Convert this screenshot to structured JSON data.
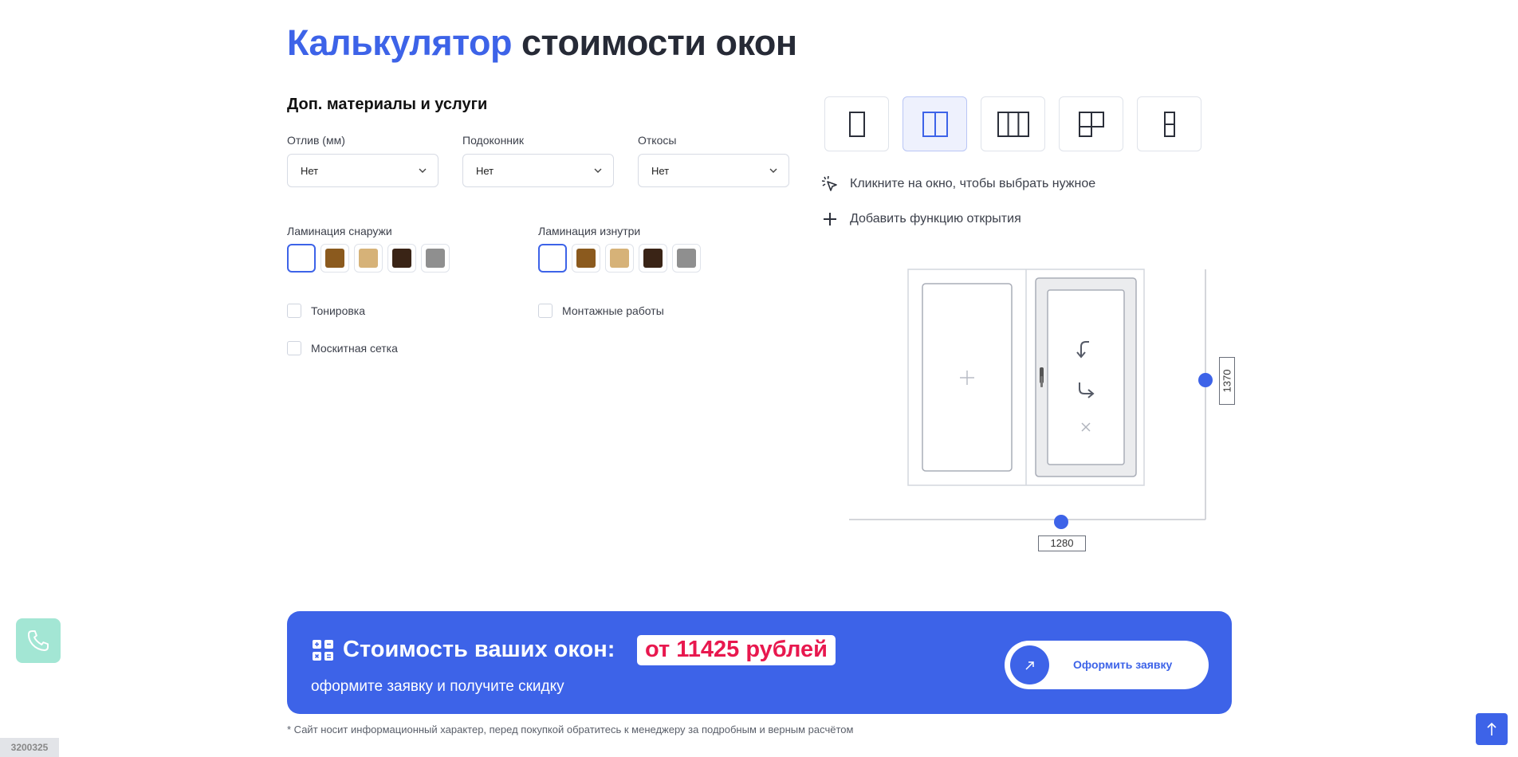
{
  "title": {
    "accent": "Калькулятор",
    "rest": "стоимости окон"
  },
  "section_title": "Доп. материалы и услуги",
  "selects": [
    {
      "label": "Отлив (мм)",
      "value": "Нет"
    },
    {
      "label": "Подоконник",
      "value": "Нет"
    },
    {
      "label": "Откосы",
      "value": "Нет"
    }
  ],
  "lamination_outside": {
    "label": "Ламинация снаружи",
    "selected_index": 0
  },
  "lamination_inside": {
    "label": "Ламинация изнутри",
    "selected_index": 0
  },
  "lamination_colors": [
    "#ffffff",
    "#8b5a1e",
    "#d6b278",
    "#3a2416",
    "#8f8f8f"
  ],
  "checkboxes": {
    "tinting": "Тонировка",
    "installation": "Монтажные работы",
    "mosquito_net": "Москитная сетка"
  },
  "window_types": [
    "single-sash",
    "double-sash",
    "triple-sash",
    "combined-sash",
    "balcony-door"
  ],
  "active_window_type": "double-sash",
  "hint_click": "Кликните на окно, чтобы выбрать нужное",
  "add_opening": "Добавить функцию открытия",
  "dimensions": {
    "width": "1280",
    "height": "1370"
  },
  "price": {
    "title": "Стоимость ваших окон:",
    "value": "от 11425 рублей",
    "subtitle": "оформите заявку и получите скидку",
    "button": "Оформить заявку"
  },
  "disclaimer": "* Сайт носит информационный характер, перед покупкой обратитесь к менеджеру за подробным и верным расчётом",
  "corner_id": "3200325",
  "colors": {
    "accent": "#3d63e8",
    "price_text": "#e8184e",
    "phone_fab": "#a3e6d4"
  }
}
